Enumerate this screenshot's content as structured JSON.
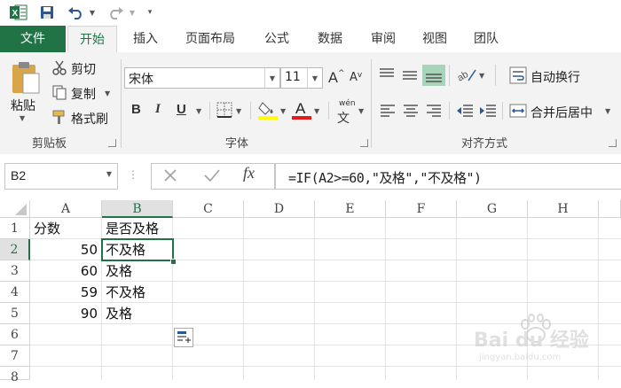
{
  "quick_access": {
    "app_icon": "excel-logo-icon",
    "save_icon": "save-icon",
    "undo_icon": "undo-icon",
    "redo_icon": "redo-icon",
    "customize_icon": "customize-qat-icon"
  },
  "tabs": [
    "文件",
    "开始",
    "插入",
    "页面布局",
    "公式",
    "数据",
    "审阅",
    "视图",
    "团队"
  ],
  "active_tab": "开始",
  "ribbon": {
    "clipboard": {
      "paste": "粘贴",
      "cut": "剪切",
      "copy": "复制",
      "format_painter": "格式刷",
      "label": "剪贴板"
    },
    "font": {
      "font_name": "宋体",
      "font_size": "11",
      "bold": "B",
      "italic": "I",
      "underline": "U",
      "grow": "A",
      "shrink": "A",
      "label": "字体",
      "phonetic": "wén"
    },
    "alignment": {
      "wrap_text": "自动换行",
      "merge_center": "合并后居中",
      "label": "对齐方式"
    }
  },
  "formula_bar": {
    "name_box": "B2",
    "formula": "=IF(A2>=60,\"及格\",\"不及格\")",
    "fx": "fx"
  },
  "columns": [
    "A",
    "B",
    "C",
    "D",
    "E",
    "F",
    "G",
    "H"
  ],
  "selected_column": "B",
  "rows": [
    "1",
    "2",
    "3",
    "4",
    "5",
    "6",
    "7",
    "8"
  ],
  "selected_row": "2",
  "cells": {
    "A1": "分数",
    "B1": "是否及格",
    "A2": "50",
    "B2": "不及格",
    "A3": "60",
    "B3": "及格",
    "A4": "59",
    "B4": "不及格",
    "A5": "90",
    "B5": "及格"
  },
  "colors": {
    "excel_green": "#217346",
    "font_color_bar": "#e31b1b",
    "highlight_bar": "#ffff00"
  },
  "watermark": {
    "brand": "Bai du 经验",
    "url": "jingyan.baidu.com"
  }
}
